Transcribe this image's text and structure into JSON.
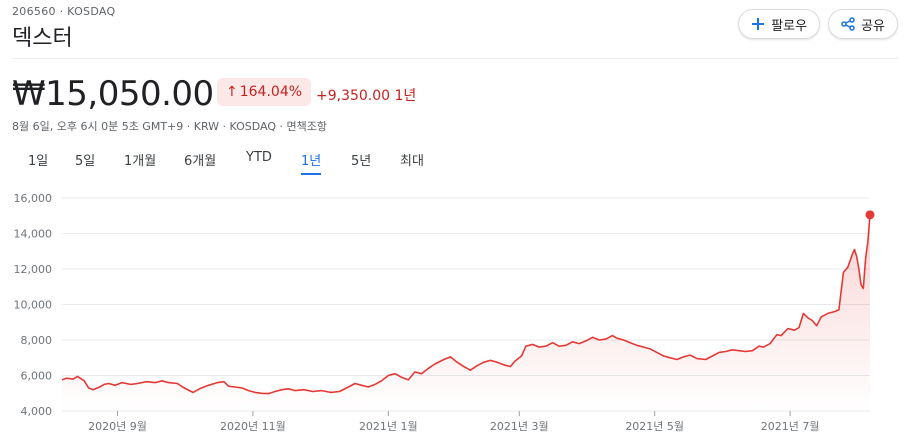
{
  "header": {
    "ticker": "206560 · KOSDAQ",
    "company": "덱스터",
    "follow_label": "팔로우",
    "share_label": "공유",
    "follow_icon": "plus-icon",
    "share_icon": "share-icon"
  },
  "quote": {
    "price": "₩15,050.00",
    "change_pct": "164.04%",
    "change_abs": "+9,350.00 1년",
    "meta": "8월 6일, 오후 6시 0분 5초 GMT+9 · KRW · KOSDAQ · 면책조항"
  },
  "colors": {
    "positive": "#c5221f",
    "line": "#e53935",
    "accent": "#1a73e8",
    "grid": "#e8eaed"
  },
  "ranges": {
    "items": [
      {
        "label": "1일"
      },
      {
        "label": "5일"
      },
      {
        "label": "1개월"
      },
      {
        "label": "6개월"
      },
      {
        "label": "YTD"
      },
      {
        "label": "1년"
      },
      {
        "label": "5년"
      },
      {
        "label": "최대"
      }
    ],
    "active": "1년"
  },
  "chart_data": {
    "type": "area",
    "title": "",
    "xlabel": "",
    "ylabel": "",
    "ylim": [
      4000,
      16000
    ],
    "y_ticks": [
      4000,
      6000,
      8000,
      10000,
      12000,
      14000,
      16000
    ],
    "y_tick_labels": [
      "4,000",
      "6,000",
      "8,000",
      "10,000",
      "12,000",
      "14,000",
      "16,000"
    ],
    "x_ticks": [
      {
        "label": "2020년 9월",
        "date": "2020-09-01"
      },
      {
        "label": "2020년 11월",
        "date": "2020-11-01"
      },
      {
        "label": "2021년 1월",
        "date": "2021-01-01"
      },
      {
        "label": "2021년 3월",
        "date": "2021-03-01"
      },
      {
        "label": "2021년 5월",
        "date": "2021-05-01"
      },
      {
        "label": "2021년 7월",
        "date": "2021-07-01"
      }
    ],
    "grid": true,
    "series": [
      {
        "points": [
          [
            "2020-08-07",
            5750
          ],
          [
            "2020-08-09",
            5850
          ],
          [
            "2020-08-12",
            5800
          ],
          [
            "2020-08-14",
            5950
          ],
          [
            "2020-08-17",
            5700
          ],
          [
            "2020-08-19",
            5300
          ],
          [
            "2020-08-21",
            5200
          ],
          [
            "2020-08-24",
            5350
          ],
          [
            "2020-08-26",
            5500
          ],
          [
            "2020-08-28",
            5550
          ],
          [
            "2020-08-31",
            5450
          ],
          [
            "2020-09-03",
            5600
          ],
          [
            "2020-09-07",
            5500
          ],
          [
            "2020-09-10",
            5550
          ],
          [
            "2020-09-14",
            5650
          ],
          [
            "2020-09-18",
            5600
          ],
          [
            "2020-09-21",
            5700
          ],
          [
            "2020-09-24",
            5600
          ],
          [
            "2020-09-28",
            5550
          ],
          [
            "2020-10-01",
            5300
          ],
          [
            "2020-10-05",
            5050
          ],
          [
            "2020-10-08",
            5250
          ],
          [
            "2020-10-12",
            5450
          ],
          [
            "2020-10-16",
            5600
          ],
          [
            "2020-10-19",
            5650
          ],
          [
            "2020-10-21",
            5400
          ],
          [
            "2020-10-24",
            5350
          ],
          [
            "2020-10-27",
            5300
          ],
          [
            "2020-10-30",
            5150
          ],
          [
            "2020-11-02",
            5050
          ],
          [
            "2020-11-05",
            5000
          ],
          [
            "2020-11-08",
            4980
          ],
          [
            "2020-11-11",
            5100
          ],
          [
            "2020-11-14",
            5200
          ],
          [
            "2020-11-17",
            5250
          ],
          [
            "2020-11-20",
            5150
          ],
          [
            "2020-11-24",
            5200
          ],
          [
            "2020-11-28",
            5100
          ],
          [
            "2020-12-02",
            5150
          ],
          [
            "2020-12-06",
            5050
          ],
          [
            "2020-12-10",
            5100
          ],
          [
            "2020-12-14",
            5350
          ],
          [
            "2020-12-17",
            5550
          ],
          [
            "2020-12-20",
            5450
          ],
          [
            "2020-12-23",
            5350
          ],
          [
            "2020-12-26",
            5500
          ],
          [
            "2020-12-29",
            5700
          ],
          [
            "2021-01-01",
            6000
          ],
          [
            "2021-01-04",
            6100
          ],
          [
            "2021-01-07",
            5900
          ],
          [
            "2021-01-10",
            5750
          ],
          [
            "2021-01-13",
            6200
          ],
          [
            "2021-01-16",
            6100
          ],
          [
            "2021-01-19",
            6400
          ],
          [
            "2021-01-22",
            6650
          ],
          [
            "2021-01-26",
            6900
          ],
          [
            "2021-01-29",
            7050
          ],
          [
            "2021-02-01",
            6750
          ],
          [
            "2021-02-04",
            6500
          ],
          [
            "2021-02-07",
            6300
          ],
          [
            "2021-02-10",
            6550
          ],
          [
            "2021-02-13",
            6750
          ],
          [
            "2021-02-16",
            6850
          ],
          [
            "2021-02-19",
            6750
          ],
          [
            "2021-02-22",
            6600
          ],
          [
            "2021-02-25",
            6500
          ],
          [
            "2021-02-27",
            6800
          ],
          [
            "2021-03-02",
            7100
          ],
          [
            "2021-03-04",
            7650
          ],
          [
            "2021-03-07",
            7750
          ],
          [
            "2021-03-10",
            7600
          ],
          [
            "2021-03-13",
            7650
          ],
          [
            "2021-03-16",
            7850
          ],
          [
            "2021-03-19",
            7650
          ],
          [
            "2021-03-22",
            7700
          ],
          [
            "2021-03-25",
            7900
          ],
          [
            "2021-03-28",
            7800
          ],
          [
            "2021-03-31",
            7950
          ],
          [
            "2021-04-03",
            8150
          ],
          [
            "2021-04-06",
            8000
          ],
          [
            "2021-04-09",
            8050
          ],
          [
            "2021-04-12",
            8250
          ],
          [
            "2021-04-14",
            8100
          ],
          [
            "2021-04-17",
            8000
          ],
          [
            "2021-04-20",
            7850
          ],
          [
            "2021-04-23",
            7700
          ],
          [
            "2021-04-26",
            7600
          ],
          [
            "2021-04-29",
            7500
          ],
          [
            "2021-05-02",
            7300
          ],
          [
            "2021-05-05",
            7100
          ],
          [
            "2021-05-08",
            7000
          ],
          [
            "2021-05-11",
            6900
          ],
          [
            "2021-05-14",
            7050
          ],
          [
            "2021-05-17",
            7150
          ],
          [
            "2021-05-20",
            6950
          ],
          [
            "2021-05-24",
            6900
          ],
          [
            "2021-05-27",
            7100
          ],
          [
            "2021-05-30",
            7300
          ],
          [
            "2021-06-02",
            7350
          ],
          [
            "2021-06-05",
            7450
          ],
          [
            "2021-06-08",
            7400
          ],
          [
            "2021-06-11",
            7350
          ],
          [
            "2021-06-14",
            7400
          ],
          [
            "2021-06-17",
            7650
          ],
          [
            "2021-06-19",
            7600
          ],
          [
            "2021-06-22",
            7800
          ],
          [
            "2021-06-25",
            8300
          ],
          [
            "2021-06-27",
            8250
          ],
          [
            "2021-06-30",
            8650
          ],
          [
            "2021-07-03",
            8550
          ],
          [
            "2021-07-05",
            8700
          ],
          [
            "2021-07-07",
            9500
          ],
          [
            "2021-07-09",
            9250
          ],
          [
            "2021-07-11",
            9100
          ],
          [
            "2021-07-13",
            8800
          ],
          [
            "2021-07-15",
            9300
          ],
          [
            "2021-07-18",
            9500
          ],
          [
            "2021-07-21",
            9600
          ],
          [
            "2021-07-23",
            9700
          ],
          [
            "2021-07-25",
            11800
          ],
          [
            "2021-07-27",
            12100
          ],
          [
            "2021-07-29",
            12800
          ],
          [
            "2021-07-30",
            13100
          ],
          [
            "2021-07-31",
            12700
          ],
          [
            "2021-08-01",
            12000
          ],
          [
            "2021-08-02",
            11100
          ],
          [
            "2021-08-03",
            10900
          ],
          [
            "2021-08-04",
            12600
          ],
          [
            "2021-08-05",
            13500
          ],
          [
            "2021-08-06",
            15050
          ]
        ]
      }
    ]
  }
}
